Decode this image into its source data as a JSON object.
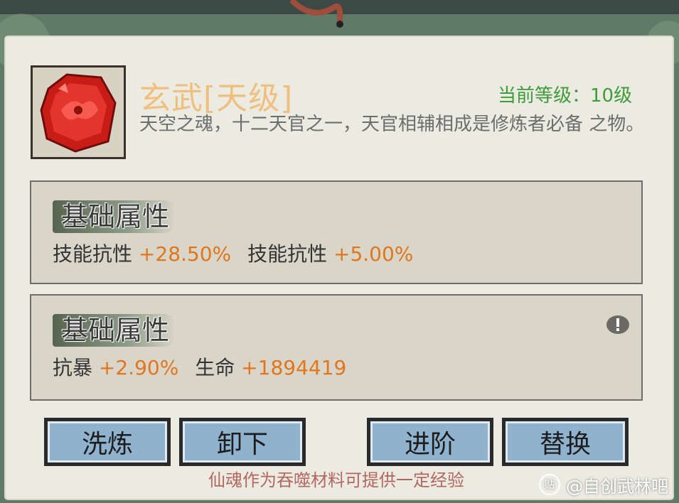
{
  "item": {
    "name": "玄武[天级]",
    "level_text": "当前等级：10级",
    "description": "天空之魂，十二天官之一，天官相辅相成是修炼者必备 之物。",
    "icon": "red-gem-icon"
  },
  "attributes": [
    {
      "title": "基础属性",
      "stats": [
        {
          "label": "技能抗性",
          "value": "+28.50%"
        },
        {
          "label": "技能抗性",
          "value": "+5.00%"
        }
      ]
    },
    {
      "title": "基础属性",
      "stats": [
        {
          "label": "抗暴",
          "value": "+2.90%"
        },
        {
          "label": "生命",
          "value": "+1894419"
        }
      ],
      "icon": "info-icon"
    }
  ],
  "buttons": {
    "refine": "洗炼",
    "unequip": "卸下",
    "advance": "进阶",
    "replace": "替换"
  },
  "hint": "仙魂作为吞噬材料可提供一定经验",
  "watermark": {
    "logo": "贴",
    "text": "@自创武林吧"
  },
  "colors": {
    "name": "#eebf7e",
    "level": "#3f9c3a",
    "stat_value": "#e0761d",
    "button": "#8fb2cf",
    "hint": "#b46661"
  }
}
